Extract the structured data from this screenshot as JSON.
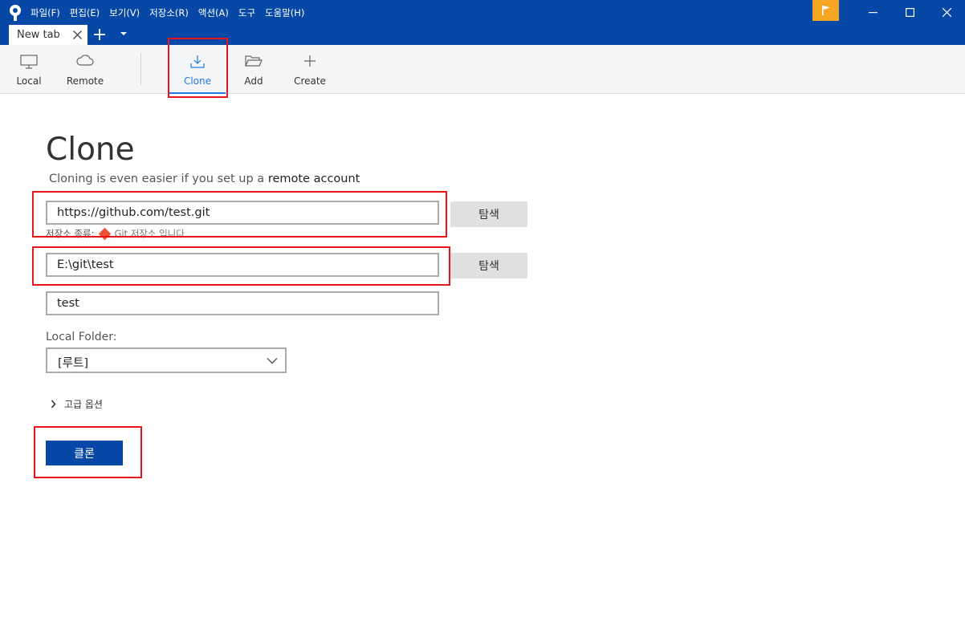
{
  "menu": [
    "파일(F)",
    "편집(E)",
    "보기(V)",
    "저장소(R)",
    "액션(A)",
    "도구",
    "도움말(H)"
  ],
  "tab": {
    "label": "New tab"
  },
  "toolbar": {
    "local": "Local",
    "remote": "Remote",
    "clone": "Clone",
    "add": "Add",
    "create": "Create"
  },
  "page": {
    "title": "Clone",
    "subtitle_prefix": "Cloning is even easier if you set up a",
    "subtitle_link": "remote account"
  },
  "form": {
    "source_url": "https://github.com/test.git",
    "browse_label": "탐색",
    "repo_type_label": "저장소 종류:",
    "repo_type_value": "Git 저장소 입니다",
    "destination_path": "E:\\git\\test",
    "name": "test",
    "local_folder_label": "Local Folder:",
    "local_folder_value": "[루트]",
    "advanced_label": "고급 옵션",
    "clone_button": "클론"
  },
  "colors": {
    "accent": "#0747a6",
    "active_tab": "#1e7be0",
    "highlight": "#e8141b",
    "flag": "#f5a623"
  }
}
